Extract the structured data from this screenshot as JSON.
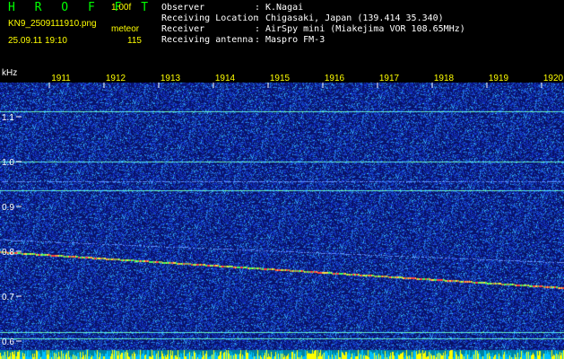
{
  "header": {
    "app_title": "H R O F F T",
    "app_version": "1.00f",
    "file_name": "KN9_2509111910.png",
    "mode": "meteor",
    "date_time": "25.09.11 19:10",
    "count": "115",
    "info": [
      {
        "label": "Observer",
        "value": "K.Nagai"
      },
      {
        "label": "Receiving Location",
        "value": "Chigasaki, Japan (139.414 35.340)"
      },
      {
        "label": "Receiver",
        "value": "AirSpy mini (Miakejima VOR 108.65MHz)"
      },
      {
        "label": "Receiving antenna",
        "value": "Maspro FM-3"
      }
    ],
    "separator": ":"
  },
  "chart_data": {
    "type": "heatmap",
    "title": "",
    "ylabel": "kHz",
    "xlabel": "",
    "x_ticks": [
      "1911",
      "1912",
      "1913",
      "1914",
      "1915",
      "1916",
      "1917",
      "1918",
      "1919",
      "1920"
    ],
    "y_ticks": [
      "1.1",
      "1.0",
      "0.9",
      "0.8",
      "0.7",
      "0.6"
    ],
    "ylim": [
      0.58,
      1.21
    ],
    "traces": [
      {
        "y": 1.113,
        "desc": "horizontal carrier line"
      },
      {
        "y": 1.0,
        "desc": "horizontal line"
      },
      {
        "y": 0.956,
        "desc": "faint horizontal line"
      },
      {
        "y": 0.937,
        "desc": "horizontal line"
      },
      {
        "y_start": 0.826,
        "y_end": 0.775,
        "desc": "faint drifting line"
      },
      {
        "y_start": 0.8,
        "y_end": 0.72,
        "desc": "drifting carrier trace"
      },
      {
        "y": 0.62,
        "desc": "horizontal line"
      },
      {
        "y": 0.607,
        "desc": "horizontal line"
      }
    ],
    "colors": {
      "background": "#0a1660",
      "noise": "#3050d0",
      "trace": "#40ff60",
      "trace_hot": "#ff4040",
      "bottom_strip": "#00c0ff",
      "bottom_bars": "#ffff00"
    }
  }
}
